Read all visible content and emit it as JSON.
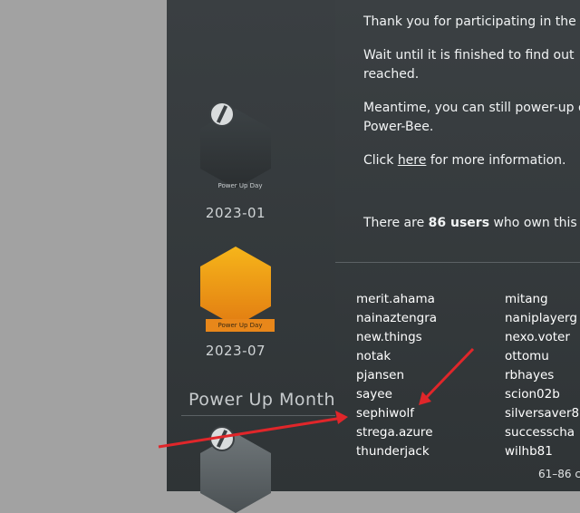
{
  "badges": [
    {
      "id": "2023-01",
      "year": "2023-01",
      "ribbon": "Power Up Day"
    },
    {
      "id": "2023-07",
      "year": "2023-07",
      "ribbon": "Power Up Day"
    }
  ],
  "section_title": "Power Up Month",
  "modal": {
    "line1": "Thank you for participating in the",
    "line2a": "Wait until it is finished to find out",
    "line2b": "reached.",
    "line3a": "Meantime, you can still power-up o",
    "line3b": "Power-Bee.",
    "click_prefix": "Click ",
    "click_link": "here",
    "click_suffix": " for more information.",
    "owners_prefix": "There are ",
    "owners_count": "86 users",
    "owners_suffix": " who own this b"
  },
  "users_left": [
    "merit.ahama",
    "nainaztengra",
    "new.things",
    "notak",
    "pjansen",
    "sayee",
    "sephiwolf",
    "strega.azure",
    "thunderjack"
  ],
  "users_right": [
    "mitang",
    "naniplayerg",
    "nexo.voter",
    "ottomu",
    "rbhayes",
    "scion02b",
    "silversaver8",
    "successcha",
    "wilhb81"
  ],
  "pagination": "61–86 c"
}
